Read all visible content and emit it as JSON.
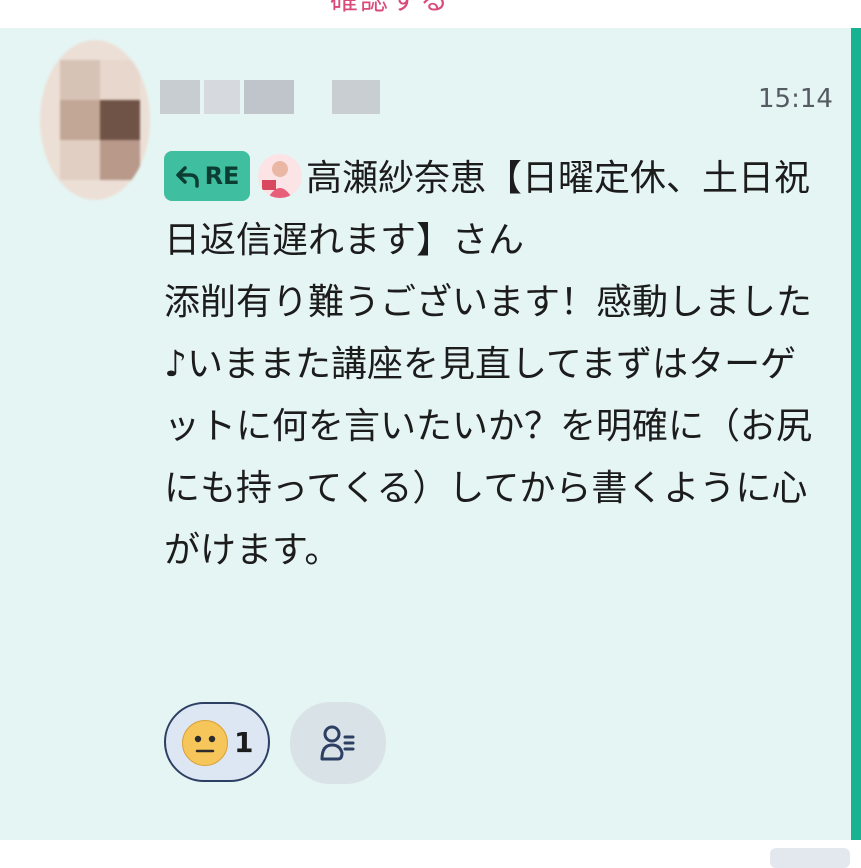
{
  "message": {
    "time": "15:14",
    "reply_badge": "RE",
    "text": "高瀬紗奈恵【日曜定休、土日祝日返信遅れます】さん\n添削有り難うございます！感動しました♪いままた講座を見直してまずはターゲットに何を言いたいか？を明確に（お尻にも持ってくる）してから書くように心がけます。"
  },
  "reaction": {
    "count": "1"
  },
  "colors": {
    "card_background": "#e5f5f3",
    "accent": "#17b28f",
    "re_badge": "#3fbf9f",
    "reaction_border": "#2d3f63"
  },
  "icons": {
    "reply": "reply-arrow-icon",
    "emoji": "smiley-face-icon",
    "read_status": "person-list-icon"
  }
}
